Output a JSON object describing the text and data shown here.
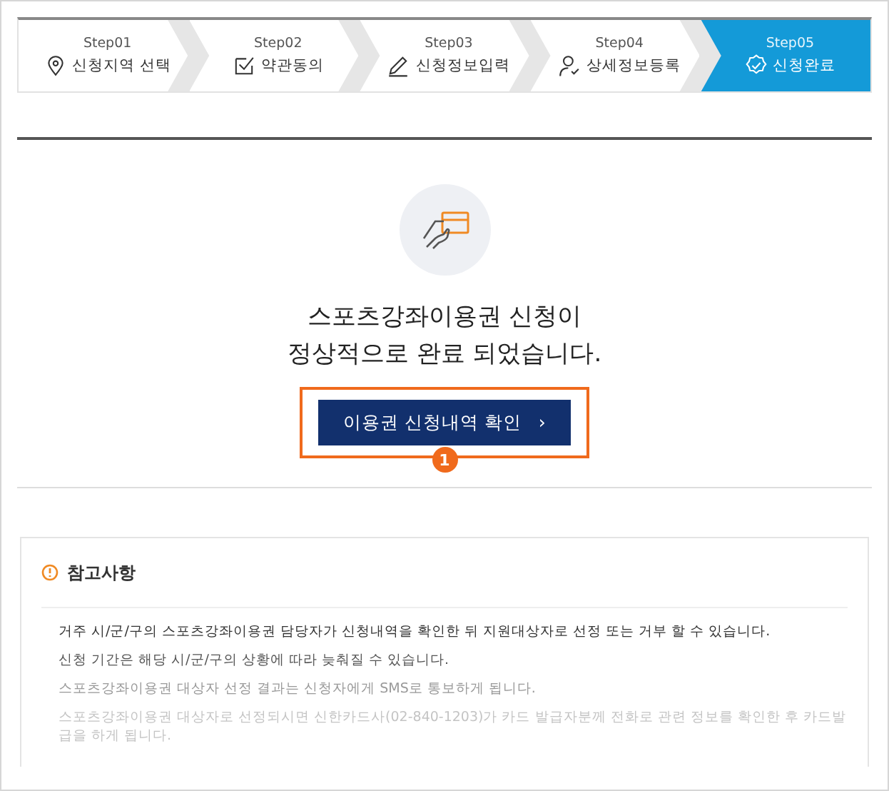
{
  "steps": [
    {
      "step": "Step01",
      "label": "신청지역 선택",
      "selected": false
    },
    {
      "step": "Step02",
      "label": "약관동의",
      "selected": false
    },
    {
      "step": "Step03",
      "label": "신청정보입력",
      "selected": false
    },
    {
      "step": "Step04",
      "label": "상세정보등록",
      "selected": false
    },
    {
      "step": "Step05",
      "label": "신청완료",
      "selected": true
    }
  ],
  "message": [
    "스포츠강좌이용권 신청이",
    "정상적으로 완료 되었습니다."
  ],
  "button": {
    "label": "이용권 신청내역 확인",
    "chevron": "›"
  },
  "callout": {
    "badge": "1"
  },
  "notes": {
    "title": "참고사항",
    "items": [
      "거주 시/군/구의 스포츠강좌이용권 담당자가 신청내역을 확인한 뒤 지원대상자로 선정 또는 거부  할 수 있습니다.",
      "신청 기간은 해당 시/군/구의 상황에 따라 늦춰질 수 있습니다.",
      "스포츠강좌이용권 대상자 선정 결과는 신청자에게 SMS로 통보하게 됩니다.",
      "스포츠강좌이용권 대상자로 선정되시면 신한카드사(02-840-1203)가 카드 발급자분께 전화로 관련 정보를 확인한 후 카드발급을 하게 됩니다."
    ]
  }
}
